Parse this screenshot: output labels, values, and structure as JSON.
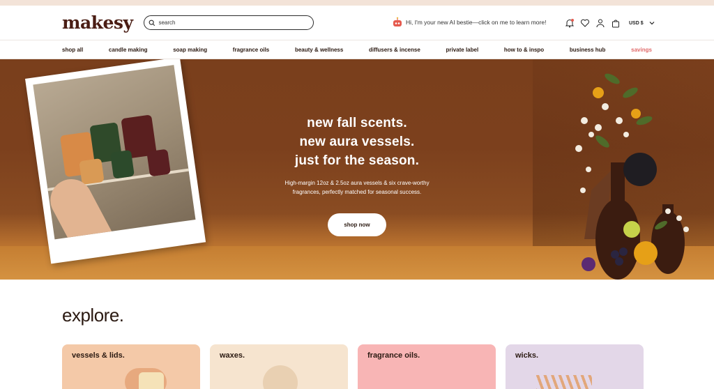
{
  "brand": {
    "logo": "makesy"
  },
  "search": {
    "placeholder": "search"
  },
  "ai_bestie": {
    "text": "Hi, I'm your new AI bestie—click on me to learn more!"
  },
  "header_actions": {
    "currency": "USD $"
  },
  "nav": {
    "items": [
      {
        "label": "shop all"
      },
      {
        "label": "candle making"
      },
      {
        "label": "soap making"
      },
      {
        "label": "fragrance oils"
      },
      {
        "label": "beauty & wellness"
      },
      {
        "label": "diffusers & incense"
      },
      {
        "label": "private label"
      },
      {
        "label": "how to & inspo"
      },
      {
        "label": "business hub"
      },
      {
        "label": "savings"
      }
    ]
  },
  "hero": {
    "title_line1": "new fall scents.",
    "title_line2": "new aura vessels.",
    "title_line3": "just for the season.",
    "subtitle_line1": "High-margin 12oz & 2.5oz aura vessels & six crave-worthy",
    "subtitle_line2": "fragrances, perfectly matched for seasonal success.",
    "cta_label": "shop now"
  },
  "explore": {
    "title": "explore.",
    "cards": [
      {
        "label": "vessels & lids.",
        "color": "#f4c9a8"
      },
      {
        "label": "waxes.",
        "color": "#f6e4cf"
      },
      {
        "label": "fragrance oils.",
        "color": "#f8b5b5"
      },
      {
        "label": "wicks.",
        "color": "#e3d7e8"
      }
    ]
  },
  "colors": {
    "accent": "#e06a6a",
    "brand": "#4a1d14",
    "hero_bg": "#7c401d"
  }
}
